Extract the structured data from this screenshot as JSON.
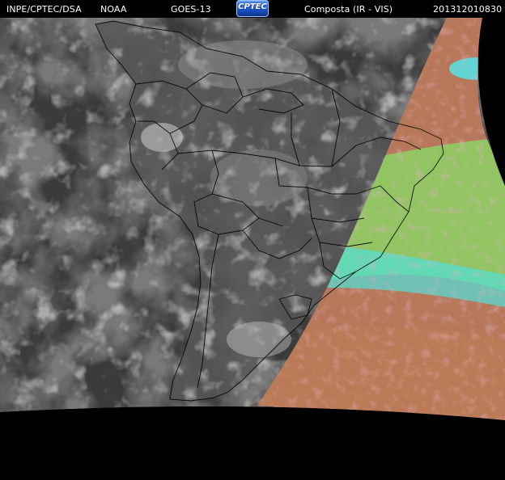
{
  "header": {
    "agency": "INPE/CPTEC/DSA",
    "noaa": "NOAA",
    "satellite": "GOES-13",
    "logo_text": "CPTEC",
    "product": "Composta (IR - VIS)",
    "timestamp": "201312010830"
  },
  "colors": {
    "background": "#000000",
    "ir_dark": "#3a3a3a",
    "ir_mid": "#5e5e5e",
    "vis_orange": "#c77a4e",
    "vis_green": "#8ee06b",
    "vis_cyan": "#4fe7e2",
    "vis_magenta": "#c27cc2",
    "borders": "#000000"
  },
  "map": {
    "region": "South America",
    "layers": [
      "IR grayscale",
      "VIS false color",
      "political borders"
    ]
  }
}
